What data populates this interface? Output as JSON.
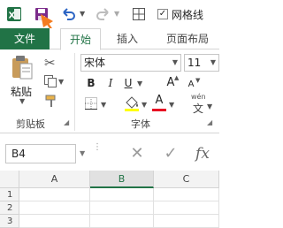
{
  "titlebar": {
    "gridlines_label": "网格线",
    "gridlines_checked": "✓"
  },
  "tabs": {
    "file": "文件",
    "home": "开始",
    "insert": "插入",
    "page_layout": "页面布局"
  },
  "clipboard": {
    "paste_label": "粘贴",
    "group_label": "剪贴板"
  },
  "font": {
    "name": "宋体",
    "size": "11",
    "bold": "B",
    "italic": "I",
    "underline": "U",
    "grow": "A",
    "shrink": "A",
    "color_letter": "A",
    "phonetic": "wén",
    "group_label": "字体"
  },
  "formula": {
    "name_box": "B4",
    "fx": "fx"
  },
  "sheet": {
    "columns": [
      "A",
      "B",
      "C"
    ],
    "rows": [
      "1",
      "2",
      "3"
    ]
  },
  "colors": {
    "brand": "#217346",
    "annotation_arrow": "#f47c20",
    "font_color_bar": "#e81123"
  }
}
